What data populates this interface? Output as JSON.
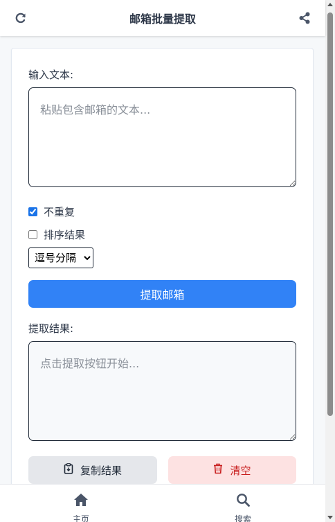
{
  "header": {
    "title": "邮箱批量提取",
    "left_icon": "refresh-icon",
    "right_icon": "share-icon"
  },
  "form": {
    "input_label": "输入文本:",
    "input_placeholder": "粘贴包含邮箱的文本...",
    "dedupe_label": "不重复",
    "dedupe_checked": true,
    "sort_label": "排序结果",
    "sort_checked": false,
    "separator_selected": "逗号分隔",
    "extract_button": "提取邮箱",
    "result_label": "提取结果:",
    "result_placeholder": "点击提取按钮开始..."
  },
  "actions": {
    "copy_label": "复制结果",
    "clear_label": "清空"
  },
  "nav": {
    "home_label": "主页",
    "search_label": "搜索"
  },
  "colors": {
    "primary": "#3182f6",
    "danger_bg": "#fde2e2",
    "danger_text": "#c81e1e"
  }
}
